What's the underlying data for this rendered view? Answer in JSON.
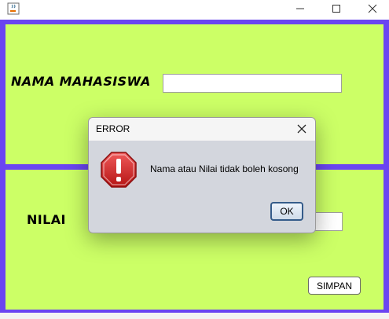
{
  "window": {
    "app_icon": "java-cup-icon",
    "controls": [
      "minimize-icon",
      "maximize-icon",
      "close-icon"
    ]
  },
  "form": {
    "nama_label": "NAMA MAHASISWA",
    "nama_value": "",
    "nilai_label": "NILAI",
    "nilai_value": "",
    "simpan_label": "SIMPAN"
  },
  "dialog": {
    "title": "ERROR",
    "message": "Nama atau Nilai tidak boleh kosong",
    "ok_label": "OK",
    "icon": "error-icon"
  },
  "colors": {
    "panel": "#ccff66",
    "border": "#6a45f1",
    "dialog_bg": "#d3d6dd",
    "error_red": "#cc1f1f"
  }
}
